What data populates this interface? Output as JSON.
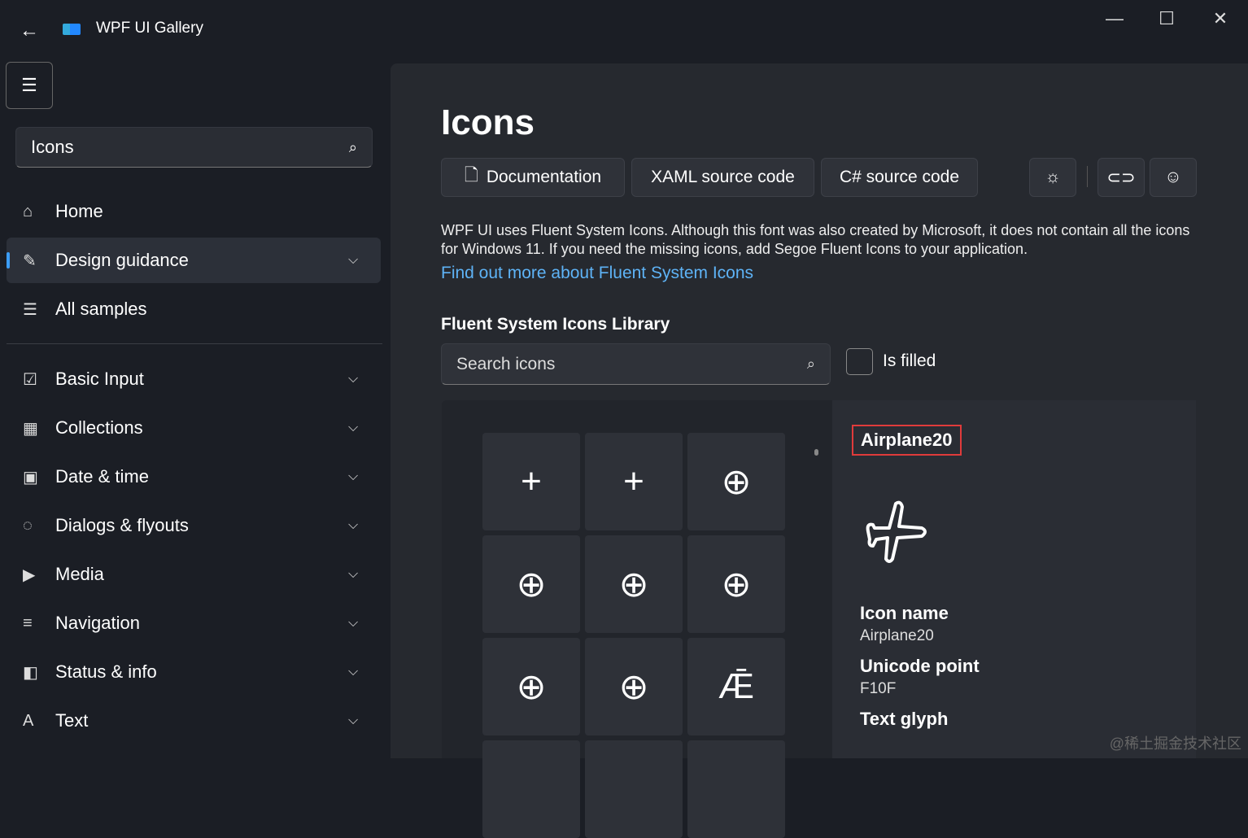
{
  "window": {
    "title": "WPF UI Gallery",
    "minimize": "—",
    "maximize": "☐",
    "close": "✕",
    "back": "←"
  },
  "sidebar": {
    "search_value": "Icons",
    "items": [
      {
        "label": "Home",
        "icon": "⌂"
      },
      {
        "label": "Design guidance",
        "icon": "✎",
        "chevron": true,
        "selected": true
      },
      {
        "label": "All samples",
        "icon": "☰"
      },
      {
        "label": "Basic Input",
        "icon": "☑",
        "chevron": true
      },
      {
        "label": "Collections",
        "icon": "▦",
        "chevron": true
      },
      {
        "label": "Date & time",
        "icon": "▣",
        "chevron": true
      },
      {
        "label": "Dialogs & flyouts",
        "icon": "◌",
        "chevron": true
      },
      {
        "label": "Media",
        "icon": "▶",
        "chevron": true
      },
      {
        "label": "Navigation",
        "icon": "≡",
        "chevron": true
      },
      {
        "label": "Status & info",
        "icon": "◧",
        "chevron": true
      },
      {
        "label": "Text",
        "icon": "A",
        "chevron": true
      }
    ]
  },
  "page": {
    "title": "Icons",
    "buttons": {
      "documentation": "Documentation",
      "xaml": "XAML source code",
      "csharp": "C# source code"
    },
    "description": "WPF UI uses Fluent System Icons. Although this font was also created by Microsoft, it does not contain all the icons for Windows 11. If you need the missing icons, add Segoe Fluent Icons to your application.",
    "link": "Find out more about Fluent System Icons",
    "library_title": "Fluent System Icons Library",
    "search_placeholder": "Search icons",
    "is_filled_label": "Is filled",
    "is_filled": false,
    "tiles": [
      "+",
      "+",
      "⊕",
      "⊕",
      "⊕",
      "⊕",
      "⊕",
      "⊕",
      "Ǣ",
      "",
      "",
      ""
    ],
    "selected": {
      "header": "Airplane20",
      "icon_name_label": "Icon name",
      "icon_name": "Airplane20",
      "unicode_label": "Unicode point",
      "unicode": "F10F",
      "glyph_label": "Text glyph"
    }
  },
  "watermark": "@稀土掘金技术社区"
}
